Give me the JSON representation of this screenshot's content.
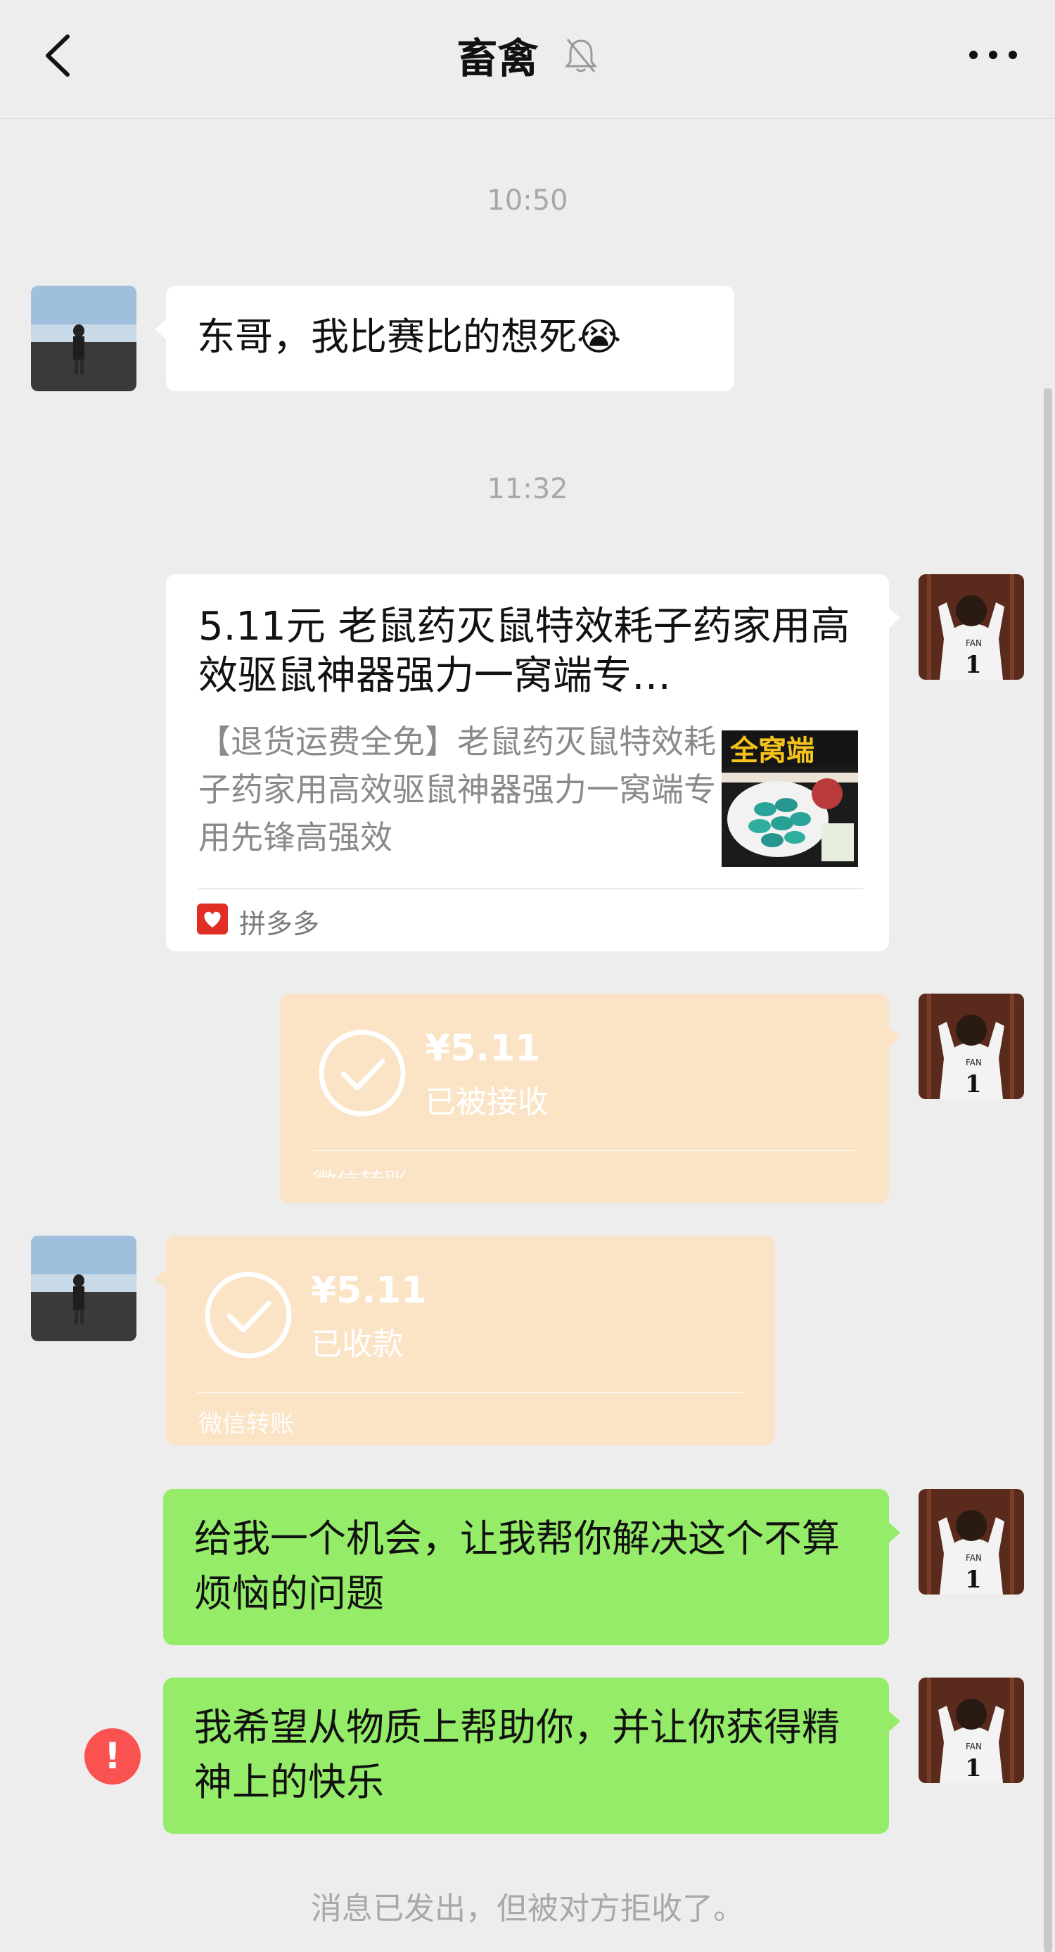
{
  "header": {
    "title": "畜禽",
    "back_icon": "chevron-left-icon",
    "mute_icon": "bell-slash-icon",
    "more_icon": "more-dots-icon"
  },
  "messages": {
    "time1": "10:50",
    "msg1": "东哥，我比赛比的想死😭",
    "time2": "11:32",
    "link_card": {
      "title": "5.11元 老鼠药灭鼠特效耗子药家用高效驱鼠神器强力一窝端专…",
      "desc": "【退货运费全免】老鼠药灭鼠特效耗子药家用高效驱鼠神器强力一窝端专用先锋高强效",
      "thumb_text": "全窝端",
      "source": "拼多多"
    },
    "transfer_sent": {
      "amount": "¥5.11",
      "status": "已被接收",
      "footer": "微信转账"
    },
    "transfer_received": {
      "amount": "¥5.11",
      "status": "已收款",
      "footer": "微信转账"
    },
    "msg_green1": "给我一个机会，让我帮你解决这个不算烦恼的问题",
    "msg_green2": "我希望从物质上帮助你，并让你获得精神上的快乐",
    "error_mark": "!",
    "rejected_notice": "消息已发出，但被对方拒收了。"
  },
  "colors": {
    "background": "#ededed",
    "green_bubble": "#95ec69",
    "transfer_bubble": "#fbe3c6",
    "error": "#fa5151"
  }
}
